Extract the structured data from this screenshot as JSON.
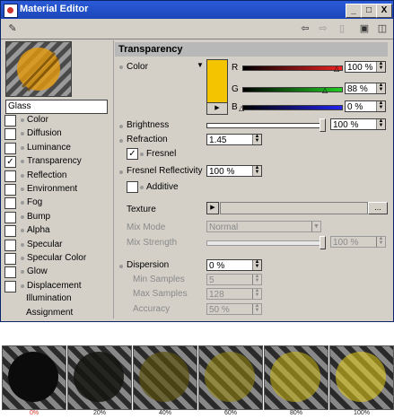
{
  "window": {
    "title": "Material Editor",
    "minimize": "_",
    "maximize": "□",
    "close": "X"
  },
  "toolbar": {
    "icons": [
      "pin-icon",
      "back-arrow-icon",
      "forward-arrow-icon",
      "trash-icon",
      "lock-icon",
      "new-window-icon"
    ]
  },
  "material": {
    "name": "Glass",
    "color": "#e59a0c"
  },
  "channels": [
    {
      "label": "Color",
      "checked": false
    },
    {
      "label": "Diffusion",
      "checked": false
    },
    {
      "label": "Luminance",
      "checked": false
    },
    {
      "label": "Transparency",
      "checked": true
    },
    {
      "label": "Reflection",
      "checked": false
    },
    {
      "label": "Environment",
      "checked": false
    },
    {
      "label": "Fog",
      "checked": false
    },
    {
      "label": "Bump",
      "checked": false
    },
    {
      "label": "Alpha",
      "checked": false
    },
    {
      "label": "Specular",
      "checked": false
    },
    {
      "label": "Specular Color",
      "checked": false
    },
    {
      "label": "Glow",
      "checked": false
    },
    {
      "label": "Displacement",
      "checked": false
    }
  ],
  "extra_items": [
    "Illumination",
    "Assignment"
  ],
  "panel": {
    "title": "Transparency",
    "color_label": "Color",
    "swatch_color": "#f5c400",
    "r_label": "R",
    "g_label": "G",
    "b_label": "B",
    "r_value": "100 %",
    "g_value": "88 %",
    "b_value": "0 %",
    "r_level": 1.0,
    "g_level": 0.88,
    "b_level": 0.0,
    "brightness_label": "Brightness",
    "brightness_value": "100 %",
    "brightness_level": 1.0,
    "refraction_label": "Refraction",
    "refraction_value": "1.45",
    "fresnel_label": "Fresnel",
    "fresnel_checked": true,
    "fresnel_refl_label": "Fresnel Reflectivity",
    "fresnel_refl_value": "100 %",
    "additive_label": "Additive",
    "additive_checked": false,
    "texture_label": "Texture",
    "texture_button": "...",
    "mixmode_label": "Mix Mode",
    "mixmode_value": "Normal",
    "mixstrength_label": "Mix Strength",
    "mixstrength_value": "100 %",
    "dispersion_label": "Dispersion",
    "dispersion_value": "0 %",
    "min_samples_label": "Min Samples",
    "min_samples_value": "5",
    "max_samples_label": "Max Samples",
    "max_samples_value": "128",
    "accuracy_label": "Accuracy",
    "accuracy_value": "50 %"
  },
  "swatches": [
    {
      "label": "0%",
      "ball": "#0b0b0b",
      "label_color": "#d03a2a"
    },
    {
      "label": "20%",
      "ball": "rgba(20,20,15,0.85)",
      "label_color": "#222222"
    },
    {
      "label": "40%",
      "ball": "rgba(90,80,10,0.65)",
      "label_color": "#222222"
    },
    {
      "label": "60%",
      "ball": "rgba(150,135,10,0.55)",
      "label_color": "#222222"
    },
    {
      "label": "80%",
      "ball": "rgba(200,180,15,0.55)",
      "label_color": "#222222"
    },
    {
      "label": "100%",
      "ball": "rgba(230,205,20,0.55)",
      "label_color": "#222222"
    }
  ]
}
